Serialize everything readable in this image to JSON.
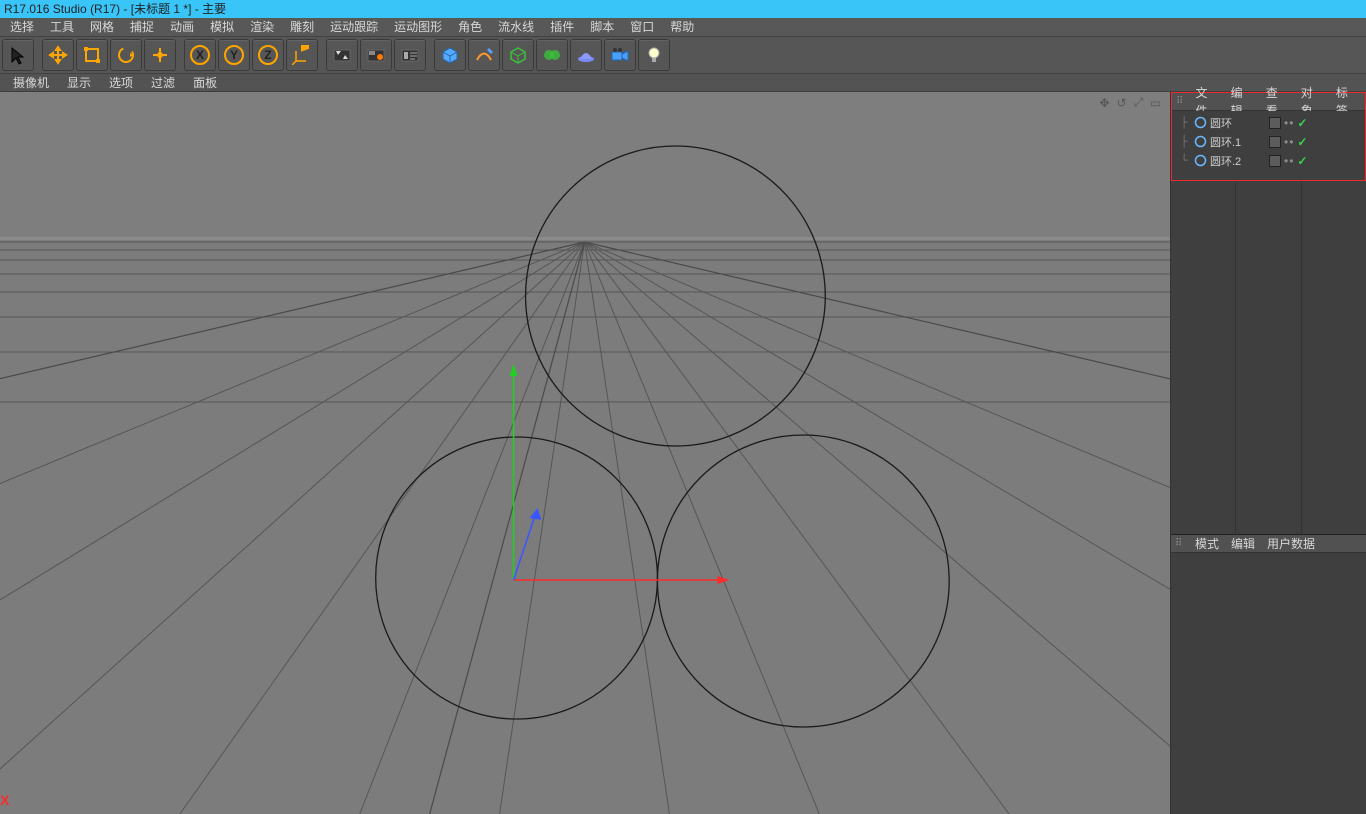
{
  "title": "R17.016 Studio (R17) - [未标题 1 *] - 主要",
  "menubar": [
    "选择",
    "工具",
    "网格",
    "捕捉",
    "动画",
    "模拟",
    "渲染",
    "雕刻",
    "运动跟踪",
    "运动图形",
    "角色",
    "流水线",
    "插件",
    "脚本",
    "窗口",
    "帮助"
  ],
  "submenu": [
    "摄像机",
    "显示",
    "选项",
    "过滤",
    "面板"
  ],
  "objectPanelTabs": [
    "文件",
    "编辑",
    "查看",
    "对象",
    "标签"
  ],
  "attrPanelTabs": [
    "模式",
    "编辑",
    "用户数据"
  ],
  "objects": [
    {
      "name": "圆环"
    },
    {
      "name": "圆环.1"
    },
    {
      "name": "圆环.2"
    }
  ],
  "axisIndicator": "X",
  "navIcons": [
    "✥",
    "↺",
    "⤢",
    "▭"
  ],
  "colors": {
    "accent": "#39c5f8",
    "xAxis": "#ff2a2a",
    "yAxis": "#2ad22a",
    "zAxis": "#3a57ff"
  }
}
